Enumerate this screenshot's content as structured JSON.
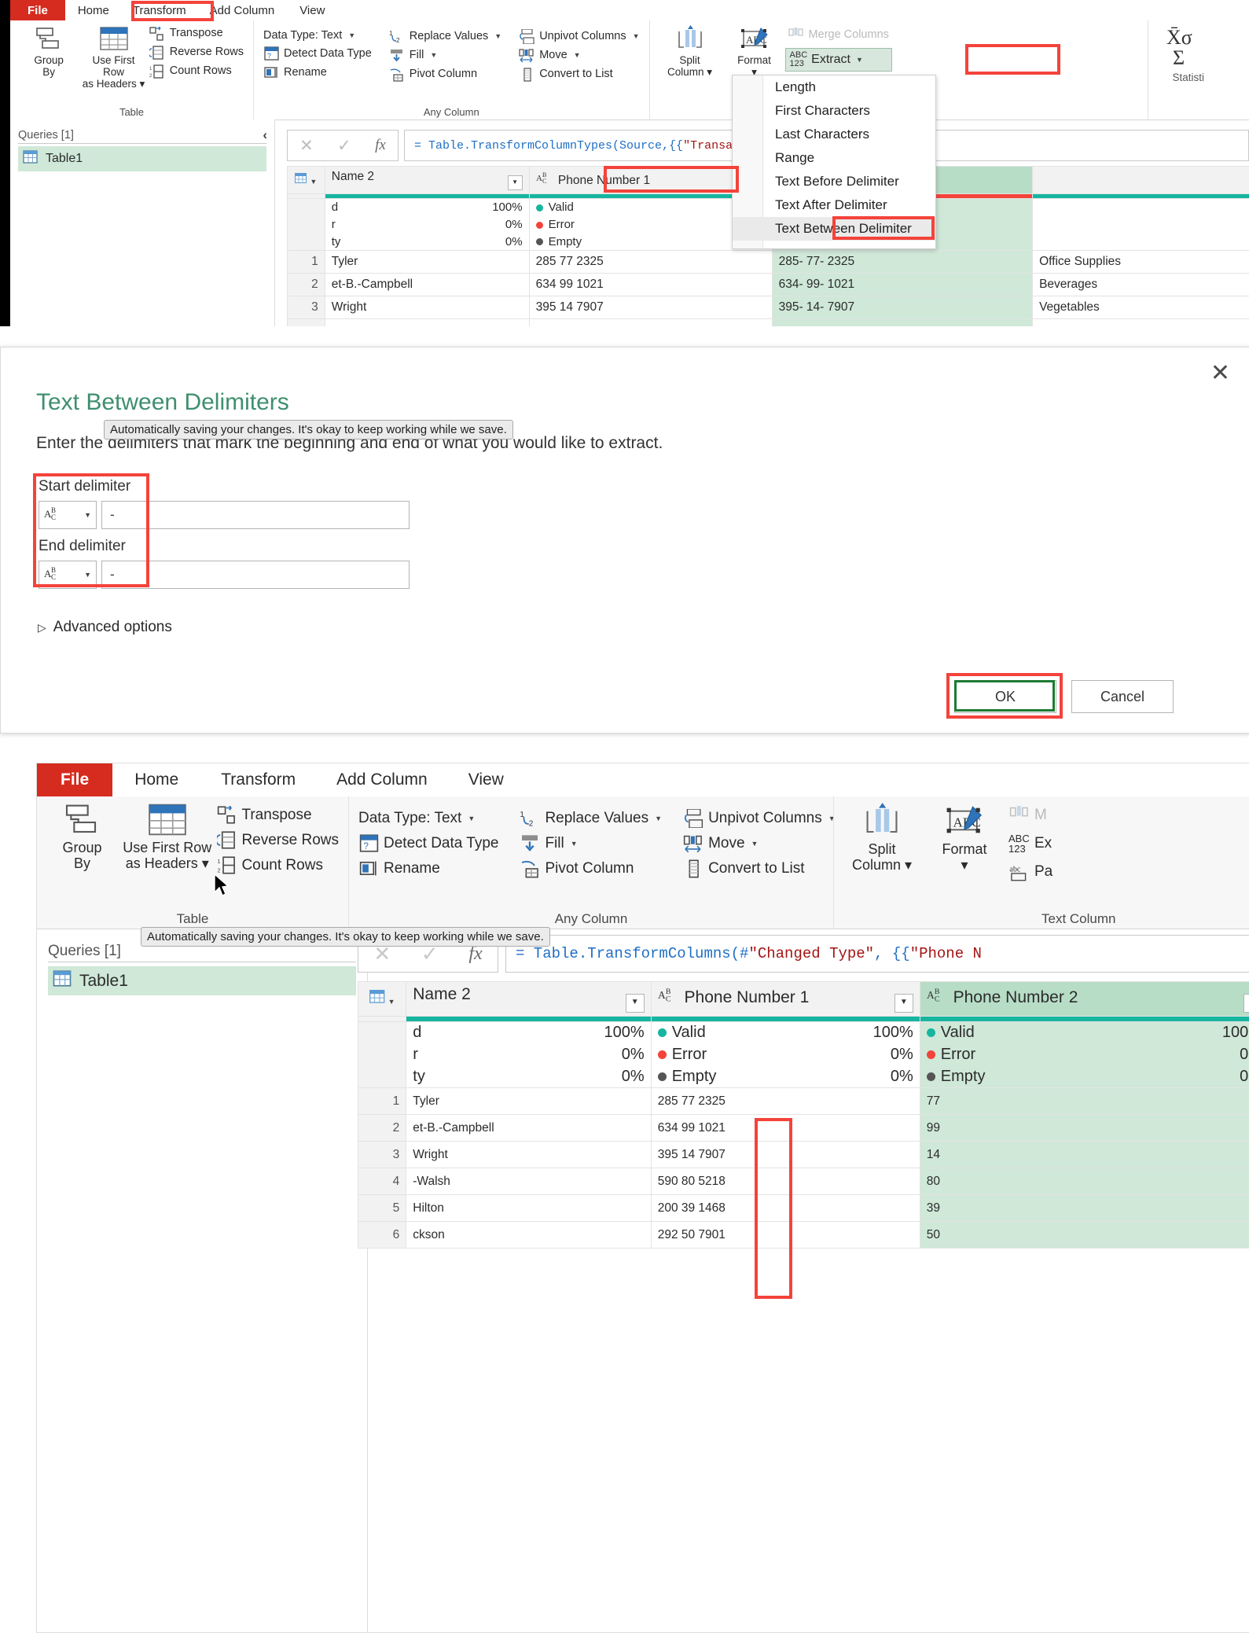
{
  "app": {
    "name": "Power Query Editor",
    "ribbon_tabs": [
      "File",
      "Home",
      "Transform",
      "Add Column",
      "View"
    ],
    "active_tab": "Transform"
  },
  "ribbon": {
    "groups": [
      {
        "label": "Table",
        "big_buttons": [
          {
            "name": "group-by-button",
            "lines": [
              "Group",
              "By"
            ],
            "icon": "group-by-icon"
          },
          {
            "name": "use-first-row-as-headers-button",
            "lines": [
              "Use First Row",
              "as Headers ▾"
            ],
            "icon": "headers-icon"
          }
        ],
        "small_buttons": [
          {
            "label": "Transpose",
            "icon": "transpose-icon"
          },
          {
            "label": "Reverse Rows",
            "icon": "reverse-rows-icon"
          },
          {
            "label": "Count Rows",
            "icon": "count-rows-icon"
          }
        ]
      },
      {
        "label": "Any Column",
        "small_buttons_a": [
          {
            "label": "Data Type: Text",
            "icon": "data-type-icon",
            "caret": true
          },
          {
            "label": "Detect Data Type",
            "icon": "detect-data-type-icon",
            "caret": false
          },
          {
            "label": "Rename",
            "icon": "rename-icon",
            "caret": false
          }
        ],
        "small_buttons_b": [
          {
            "label": "Replace Values",
            "icon": "replace-values-icon",
            "caret": true
          },
          {
            "label": "Fill",
            "icon": "fill-icon",
            "caret": true
          },
          {
            "label": "Pivot Column",
            "icon": "pivot-column-icon",
            "caret": false
          }
        ],
        "small_buttons_c": [
          {
            "label": "Unpivot Columns",
            "icon": "unpivot-columns-icon",
            "caret": true
          },
          {
            "label": "Move",
            "icon": "move-icon",
            "caret": true
          },
          {
            "label": "Convert to List",
            "icon": "convert-to-list-icon",
            "caret": false
          }
        ]
      },
      {
        "label": "Text Column",
        "label_clipped": "Text C",
        "big_buttons": [
          {
            "name": "split-column-button",
            "lines": [
              "Split",
              "Column ▾"
            ],
            "icon": "split-column-icon"
          },
          {
            "name": "format-button",
            "lines": [
              "Format",
              "▾"
            ],
            "icon": "format-icon"
          }
        ],
        "small_buttons": [
          {
            "label": "Merge Columns",
            "icon": "merge-columns-icon",
            "disabled": true
          },
          {
            "label": "Extract",
            "icon": "extract-icon",
            "caret": true
          },
          {
            "label": "Parse",
            "icon": "parse-icon",
            "caret": true
          }
        ]
      },
      {
        "label": "Statistics",
        "label_clipped": "Statisti",
        "big_buttons": [
          {
            "name": "statistics-button",
            "lines": [
              "Statistics"
            ],
            "icon": "sigma-icon"
          }
        ]
      }
    ]
  },
  "extract_menu": {
    "items": [
      "Length",
      "First Characters",
      "Last Characters",
      "Range",
      "Text Before Delimiter",
      "Text After Delimiter",
      "Text Between Delimiter"
    ],
    "highlighted": "Text Between Delimiter"
  },
  "queries_pane": {
    "title": "Queries [1]",
    "items": [
      {
        "label": "Table1",
        "icon": "table-icon",
        "selected": true
      }
    ]
  },
  "top_panel": {
    "formula": "= Table.TransformColumnTypes(Source,{{\"Transact",
    "formula_prefix": "= Table.TransformColumnTypes(Source,{{",
    "formula_string": "\"Transact",
    "columns": [
      {
        "header": "Name 2",
        "type_icon": "abc-icon",
        "has_dropdown": true,
        "selected": false
      },
      {
        "header": "Phone Number 1",
        "type_icon": "abc-icon",
        "has_dropdown": true,
        "selected": false
      },
      {
        "header": "Phone Number 2",
        "type_icon": "abc-icon",
        "has_dropdown": true,
        "selected": true
      },
      {
        "header": "",
        "type_icon": "",
        "has_dropdown": false,
        "selected": false
      }
    ],
    "quality": [
      {
        "label": "Valid",
        "pct": "100%",
        "color": "#16b5a0"
      },
      {
        "label": "Error",
        "pct": "0%",
        "color": "#f4433b"
      },
      {
        "label": "Empty",
        "pct": "0%",
        "color": "#555555"
      }
    ],
    "quality_left_clipped": [
      "d",
      "r",
      "ty"
    ],
    "rows": [
      {
        "n": "1",
        "name": "Tyler",
        "phone1": "285 77 2325",
        "phone2": "285- 77- 2325",
        "cat": "Office Supplies"
      },
      {
        "n": "2",
        "name": "et-B.-Campbell",
        "phone1": "634 99 1021",
        "phone2": "634- 99- 1021",
        "cat": "Beverages"
      },
      {
        "n": "3",
        "name": "Wright",
        "phone1": "395 14 7907",
        "phone2": "395- 14- 7907",
        "cat": "Vegetables"
      }
    ]
  },
  "dialog": {
    "title": "Text Between Delimiters",
    "subtitle": "Enter the delimiters that mark the beginning and end of what you would like to extract.",
    "tooltip": "Automatically saving your changes. It's okay to keep working while we save.",
    "start_label": "Start delimiter",
    "start_type": "ABC",
    "start_value": "-",
    "end_label": "End delimiter",
    "end_type": "ABC",
    "end_value": "-",
    "advanced_options": "Advanced options",
    "ok": "OK",
    "cancel": "Cancel",
    "close": "✕"
  },
  "bottom_panel": {
    "formula_prefix": "= Table.TransformColumns(#",
    "formula_mid": "\"Changed Type\"",
    "formula_tail": ", {{",
    "formula_string": "\"Phone N",
    "tooltip": "Automatically saving your changes. It's okay to keep working while we save.",
    "columns": [
      {
        "header": "Name 2",
        "type_icon": "table-icon",
        "has_dropdown": true,
        "selected": false
      },
      {
        "header": "Phone Number 1",
        "type_icon": "abc-icon",
        "has_dropdown": true,
        "selected": false
      },
      {
        "header": "Phone Number 2",
        "type_icon": "abc-icon",
        "has_dropdown": true,
        "selected": true
      }
    ],
    "quality": [
      {
        "label": "Valid",
        "pct": "100%",
        "color": "#16b5a0"
      },
      {
        "label": "Error",
        "pct": "0%",
        "color": "#f4433b"
      },
      {
        "label": "Empty",
        "pct": "0%",
        "color": "#555555"
      }
    ],
    "quality_left_clipped": [
      "d",
      "r",
      "ty"
    ],
    "rows": [
      {
        "n": "1",
        "name": "Tyler",
        "phone1": "285 77 2325",
        "extracted": "77"
      },
      {
        "n": "2",
        "name": "et-B.-Campbell",
        "phone1": "634 99 1021",
        "extracted": "99"
      },
      {
        "n": "3",
        "name": "Wright",
        "phone1": "395 14 7907",
        "extracted": "14"
      },
      {
        "n": "4",
        "name": "-Walsh",
        "phone1": "590 80 5218",
        "extracted": "80"
      },
      {
        "n": "5",
        "name": "Hilton",
        "phone1": "200 39 1468",
        "extracted": "39"
      },
      {
        "n": "6",
        "name": "ckson",
        "phone1": "292 50 7901",
        "extracted": "50"
      }
    ]
  },
  "colors": {
    "file_tab_red": "#d62b1f",
    "highlight_red": "#f4433b",
    "ok_green": "#1e7a33",
    "selection_green": "#cfe8d8",
    "valid_teal": "#16b5a0",
    "title_green": "#3f8f6f"
  }
}
